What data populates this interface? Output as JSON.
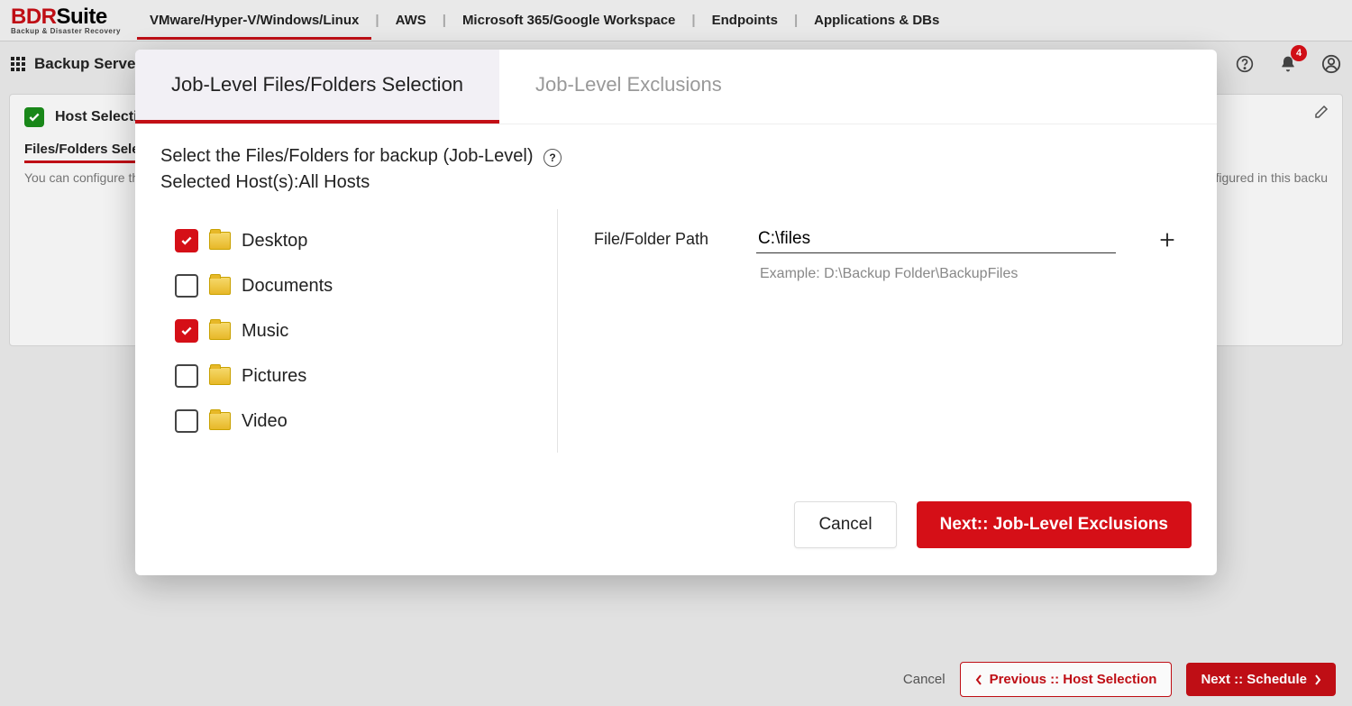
{
  "brand": {
    "line1_bold": "BDR",
    "line1_light": "Suite",
    "tagline": "Backup & Disaster Recovery"
  },
  "topnav": {
    "items": [
      "VMware/Hyper-V/Windows/Linux",
      "AWS",
      "Microsoft 365/Google Workspace",
      "Endpoints",
      "Applications & DBs"
    ],
    "active_index": 0
  },
  "secondbar": {
    "server_label": "Backup Server",
    "notification_count": "4"
  },
  "page": {
    "step_title": "Host Selection",
    "section_tab": "Files/Folders Select",
    "description_left": "You can configure the j",
    "description_right": "vel to all the hosts configured in this backu"
  },
  "bottom": {
    "cancel": "Cancel",
    "prev": "Previous :: Host Selection",
    "next": "Next :: Schedule"
  },
  "modal": {
    "tabs": {
      "selection": "Job-Level Files/Folders Selection",
      "exclusions": "Job-Level Exclusions"
    },
    "heading": "Select the Files/Folders for backup (Job-Level)",
    "selected_hosts_label": "Selected Host(s):",
    "selected_hosts_value": "All Hosts",
    "folders": [
      {
        "label": "Desktop",
        "checked": true
      },
      {
        "label": "Documents",
        "checked": false
      },
      {
        "label": "Music",
        "checked": true
      },
      {
        "label": "Pictures",
        "checked": false
      },
      {
        "label": "Video",
        "checked": false
      }
    ],
    "path_label": "File/Folder Path",
    "path_value": "C:\\files",
    "example": "Example: D:\\Backup Folder\\BackupFiles",
    "cancel": "Cancel",
    "next": "Next:: Job-Level Exclusions"
  }
}
